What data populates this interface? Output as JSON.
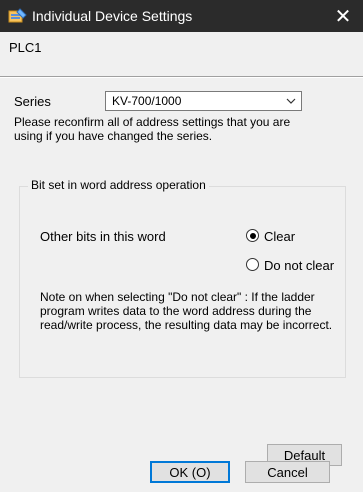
{
  "window": {
    "title": "Individual Device Settings",
    "close_glyph": "✕"
  },
  "plc_label": "PLC1",
  "series": {
    "label": "Series",
    "selected": "KV-700/1000",
    "note": "Please reconfirm all of address settings that you are using if you have changed the series."
  },
  "group": {
    "title": "Bit set in word address operation",
    "bits_label": "Other bits in this word",
    "options": [
      {
        "label": "Clear",
        "selected": true
      },
      {
        "label": "Do not clear",
        "selected": false
      }
    ],
    "note": "Note on when selecting \"Do not clear\" : If the ladder program writes data to the word address during the read/write process, the resulting data may be incorrect."
  },
  "buttons": {
    "default": "Default",
    "ok": "OK (O)",
    "cancel": "Cancel"
  },
  "icons": {
    "app": "app-settings-icon",
    "close": "close-icon",
    "dropdown": "chevron-down-icon"
  }
}
